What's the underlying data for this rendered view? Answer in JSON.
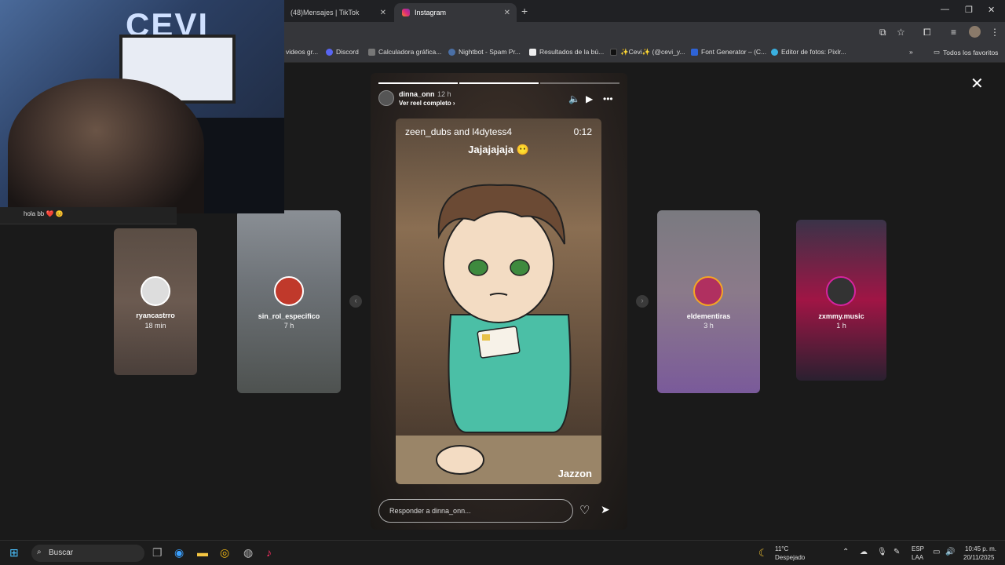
{
  "tabs": [
    {
      "label": "(48)Mensajes | TikTok"
    },
    {
      "label": "Instagram"
    }
  ],
  "bookmarks": [
    {
      "label": "videos gr..."
    },
    {
      "label": "Discord"
    },
    {
      "label": "Calculadora gráfica..."
    },
    {
      "label": "Nightbot - Spam Pr..."
    },
    {
      "label": "Resultados de la bú..."
    },
    {
      "label": "✨Cevi✨ (@cevi_y..."
    },
    {
      "label": "Font Generator – (C..."
    },
    {
      "label": "Editor de fotos: Pixlr..."
    },
    {
      "label": "Todos los favoritos"
    }
  ],
  "webcam": {
    "logo": "CEVI",
    "strip_text": "hola bb ❤️ 😊"
  },
  "side_stories": [
    {
      "user": "ryancastrro",
      "time": "18 min"
    },
    {
      "user": "sin_rol_especifico",
      "time": "7 h"
    },
    {
      "user": "eldementiras",
      "time": "3 h"
    },
    {
      "user": "zxmmy.music",
      "time": "1 h"
    }
  ],
  "story": {
    "user": "dinna_onn",
    "time": "12 h",
    "reel_link": "Ver reel completo ›",
    "video_dubs": "zeen_dubs and l4dytess4",
    "video_duration": "0:12",
    "video_caption": "Jajajajaja 😶",
    "watermark": "Jazzon",
    "reply_placeholder": "Responder a dinna_onn..."
  },
  "taskbar": {
    "search": "Buscar",
    "weather_temp": "11°C",
    "weather_desc": "Despejado",
    "lang_top": "ESP",
    "lang_bottom": "LAA",
    "time": "10:45 p. m.",
    "date": "20/11/2025"
  }
}
